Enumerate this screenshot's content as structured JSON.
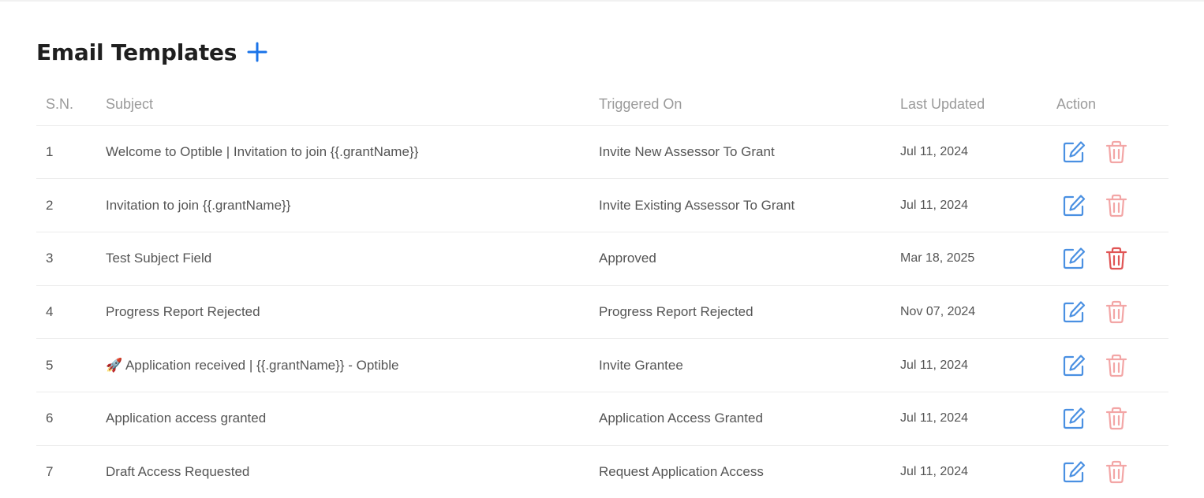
{
  "page": {
    "title": "Email Templates"
  },
  "icons": {
    "add": "plus-icon",
    "edit": "edit-icon",
    "delete": "trash-icon"
  },
  "colors": {
    "accent": "#1a73e8",
    "edit": "#4a90e2",
    "delete": "#e05555",
    "delete_muted": "#f3a6a6"
  },
  "table": {
    "columns": [
      "S.N.",
      "Subject",
      "Triggered On",
      "Last Updated",
      "Action"
    ],
    "rows": [
      {
        "sn": "1",
        "subject": "Welcome to Optible | Invitation to join {{.grantName}}",
        "triggered_on": "Invite New Assessor To Grant",
        "last_updated": "Jul 11, 2024"
      },
      {
        "sn": "2",
        "subject": "Invitation to join {{.grantName}}",
        "triggered_on": "Invite Existing Assessor To Grant",
        "last_updated": "Jul 11, 2024"
      },
      {
        "sn": "3",
        "subject": "Test Subject Field",
        "triggered_on": "Approved",
        "last_updated": "Mar 18, 2025"
      },
      {
        "sn": "4",
        "subject": "Progress Report Rejected",
        "triggered_on": "Progress Report Rejected",
        "last_updated": "Nov 07, 2024"
      },
      {
        "sn": "5",
        "subject": "🚀 Application received | {{.grantName}} - Optible",
        "triggered_on": "Invite Grantee",
        "last_updated": "Jul 11, 2024"
      },
      {
        "sn": "6",
        "subject": "Application access granted",
        "triggered_on": "Application Access Granted",
        "last_updated": "Jul 11, 2024"
      },
      {
        "sn": "7",
        "subject": "Draft Access Requested",
        "triggered_on": "Request Application Access",
        "last_updated": "Jul 11, 2024"
      }
    ]
  }
}
